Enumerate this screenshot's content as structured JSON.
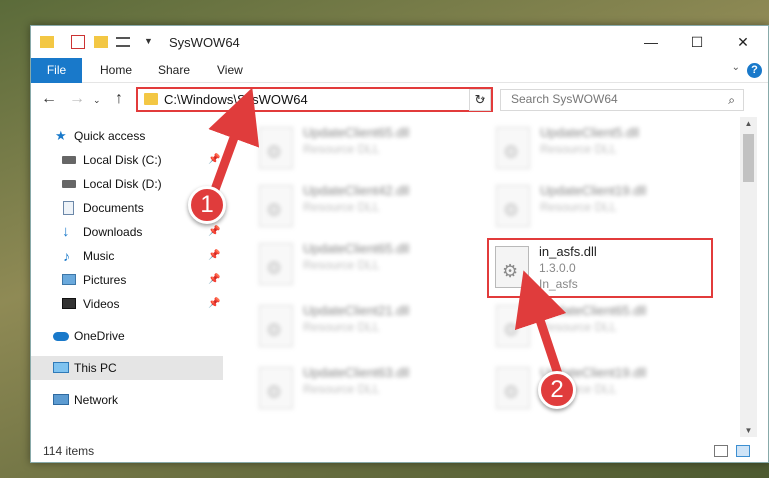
{
  "window": {
    "title": "SysWOW64"
  },
  "ribbon": {
    "file_label": "File",
    "tabs": [
      "Home",
      "Share",
      "View"
    ]
  },
  "navigation": {
    "address_path": "C:\\Windows\\SysWOW64",
    "search_placeholder": "Search SysWOW64"
  },
  "sidebar": {
    "items": [
      {
        "label": "Quick access",
        "icon": "star-icon"
      },
      {
        "label": "Local Disk (C:)",
        "icon": "drive-icon",
        "pinned": true
      },
      {
        "label": "Local Disk (D:)",
        "icon": "drive-icon"
      },
      {
        "label": "Documents",
        "icon": "documents-icon"
      },
      {
        "label": "Downloads",
        "icon": "download-icon",
        "pinned": true
      },
      {
        "label": "Music",
        "icon": "music-icon",
        "pinned": true
      },
      {
        "label": "Pictures",
        "icon": "pictures-icon",
        "pinned": true
      },
      {
        "label": "Videos",
        "icon": "videos-icon",
        "pinned": true
      },
      {
        "label": "OneDrive",
        "icon": "cloud-icon"
      },
      {
        "label": "This PC",
        "icon": "computer-icon",
        "selected": true
      },
      {
        "label": "Network",
        "icon": "network-icon"
      }
    ]
  },
  "files": [
    {
      "name": "UpdateClient65.dll",
      "type": "Resource DLL"
    },
    {
      "name": "UpdateClient5.dll",
      "type": "Resource DLL"
    },
    {
      "name": "UpdateClient42.dll",
      "type": "Resource DLL"
    },
    {
      "name": "UpdateClient19.dll",
      "type": "Resource DLL"
    },
    {
      "name": "UpdateClient65.dll",
      "type": "Resource DLL"
    },
    {
      "name": "in_asfs.dll",
      "version": "1.3.0.0",
      "description": "In_asfs",
      "highlighted": true
    },
    {
      "name": "UpdateClient21.dll",
      "type": "Resource DLL"
    },
    {
      "name": "UpdateClient65.dll",
      "type": "Resource DLL"
    },
    {
      "name": "UpdateClient63.dll",
      "type": "Resource DLL"
    },
    {
      "name": "UpdateClient19.dll",
      "type": "Resource DLL"
    }
  ],
  "status": {
    "item_count": "114 items"
  },
  "annotations": {
    "step1": "1",
    "step2": "2"
  },
  "colors": {
    "accent": "#1979ca",
    "annotation_red": "#e23b3b",
    "folder_yellow": "#f3c744"
  }
}
